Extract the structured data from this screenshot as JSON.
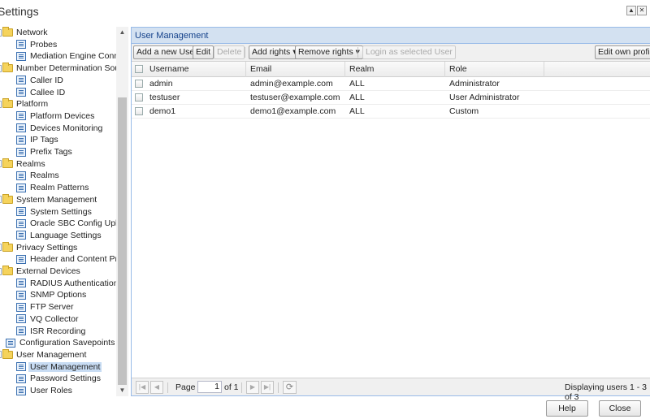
{
  "window": {
    "title": "Settings",
    "maximize_icon": "▲",
    "close_icon": "✕"
  },
  "tree": {
    "items": [
      {
        "label": "Network",
        "type": "folder",
        "indent": 0
      },
      {
        "label": "Probes",
        "type": "leaf",
        "indent": 1
      },
      {
        "label": "Mediation Engine Connectors",
        "type": "leaf",
        "indent": 1
      },
      {
        "label": "Number Determination Sources",
        "type": "folder",
        "indent": 0
      },
      {
        "label": "Caller ID",
        "type": "leaf",
        "indent": 1
      },
      {
        "label": "Callee ID",
        "type": "leaf",
        "indent": 1
      },
      {
        "label": "Platform",
        "type": "folder",
        "indent": 0
      },
      {
        "label": "Platform Devices",
        "type": "leaf",
        "indent": 1
      },
      {
        "label": "Devices Monitoring",
        "type": "leaf",
        "indent": 1
      },
      {
        "label": "IP Tags",
        "type": "leaf",
        "indent": 1
      },
      {
        "label": "Prefix Tags",
        "type": "leaf",
        "indent": 1
      },
      {
        "label": "Realms",
        "type": "folder",
        "indent": 0
      },
      {
        "label": "Realms",
        "type": "leaf",
        "indent": 1
      },
      {
        "label": "Realm Patterns",
        "type": "leaf",
        "indent": 1
      },
      {
        "label": "System Management",
        "type": "folder",
        "indent": 0
      },
      {
        "label": "System Settings",
        "type": "leaf",
        "indent": 1
      },
      {
        "label": "Oracle SBC Config Upload",
        "type": "leaf",
        "indent": 1
      },
      {
        "label": "Language Settings",
        "type": "leaf",
        "indent": 1
      },
      {
        "label": "Privacy Settings",
        "type": "folder",
        "indent": 0
      },
      {
        "label": "Header and Content Privacy",
        "type": "leaf",
        "indent": 1
      },
      {
        "label": "External Devices",
        "type": "folder",
        "indent": 0
      },
      {
        "label": "RADIUS Authentication",
        "type": "leaf",
        "indent": 1
      },
      {
        "label": "SNMP Options",
        "type": "leaf",
        "indent": 1
      },
      {
        "label": "FTP Server",
        "type": "leaf",
        "indent": 1
      },
      {
        "label": "VQ Collector",
        "type": "leaf",
        "indent": 1
      },
      {
        "label": "ISR Recording",
        "type": "leaf",
        "indent": 1
      },
      {
        "label": "Configuration Savepoints",
        "type": "leaf",
        "indent": 0
      },
      {
        "label": "User Management",
        "type": "folder",
        "indent": 0
      },
      {
        "label": "User Management",
        "type": "leaf",
        "indent": 1,
        "selected": true
      },
      {
        "label": "Password Settings",
        "type": "leaf",
        "indent": 1
      },
      {
        "label": "User Roles",
        "type": "leaf",
        "indent": 1
      }
    ]
  },
  "panel": {
    "title": "User Management",
    "toolbar": {
      "add_user": "Add a new User",
      "edit": "Edit",
      "delete": "Delete",
      "add_rights": "Add rights ▾",
      "remove_rights": "Remove rights ▾",
      "login_as": "Login as selected User",
      "edit_own_profile": "Edit own profile"
    },
    "columns": [
      "Username",
      "Email",
      "Realm",
      "Role"
    ],
    "rows": [
      {
        "username": "admin",
        "email": "admin@example.com",
        "realm": "ALL",
        "role": "Administrator"
      },
      {
        "username": "testuser",
        "email": "testuser@example.com",
        "realm": "ALL",
        "role": "User Administrator"
      },
      {
        "username": "demo1",
        "email": "demo1@example.com",
        "realm": "ALL",
        "role": "Custom"
      }
    ],
    "pager": {
      "page_label": "Page",
      "page_value": "1",
      "of_label": "of 1",
      "display_text": "Displaying users 1 - 3 of 3"
    }
  },
  "buttons": {
    "help": "Help",
    "close": "Close"
  }
}
